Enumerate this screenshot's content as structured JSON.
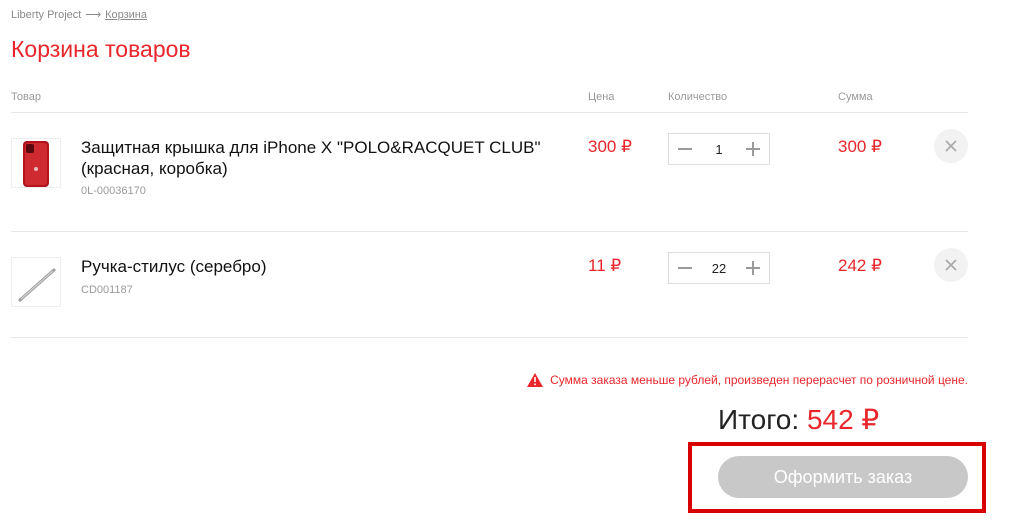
{
  "breadcrumb": {
    "root": "Liberty Project",
    "separator": "⟶",
    "current": "Корзина"
  },
  "page_title": "Корзина товаров",
  "columns": {
    "product": "Товар",
    "price": "Цена",
    "quantity": "Количество",
    "sum": "Сумма"
  },
  "items": [
    {
      "name": "Защитная крышка для iPhone X \"POLO&RACQUET CLUB\" (красная, коробка)",
      "code": "0L-00036170",
      "price": "300 ₽",
      "quantity": "1",
      "sum": "300 ₽",
      "thumb_icon": "red-phone-case-image"
    },
    {
      "name": "Ручка-стилус (серебро)",
      "code": "CD001187",
      "price": "11 ₽",
      "quantity": "22",
      "sum": "242 ₽",
      "thumb_icon": "stylus-pen-image"
    }
  ],
  "warning": {
    "icon": "warning-triangle-icon",
    "text": "Сумма заказа меньше рублей, произведен перерасчет по розничной цене."
  },
  "total": {
    "label": "Итого:",
    "amount": "542 ₽"
  },
  "checkout_label": "Оформить заказ",
  "colors": {
    "accent": "#e8262b",
    "button_disabled": "#c8c8c8",
    "highlight_frame": "#d80000"
  }
}
